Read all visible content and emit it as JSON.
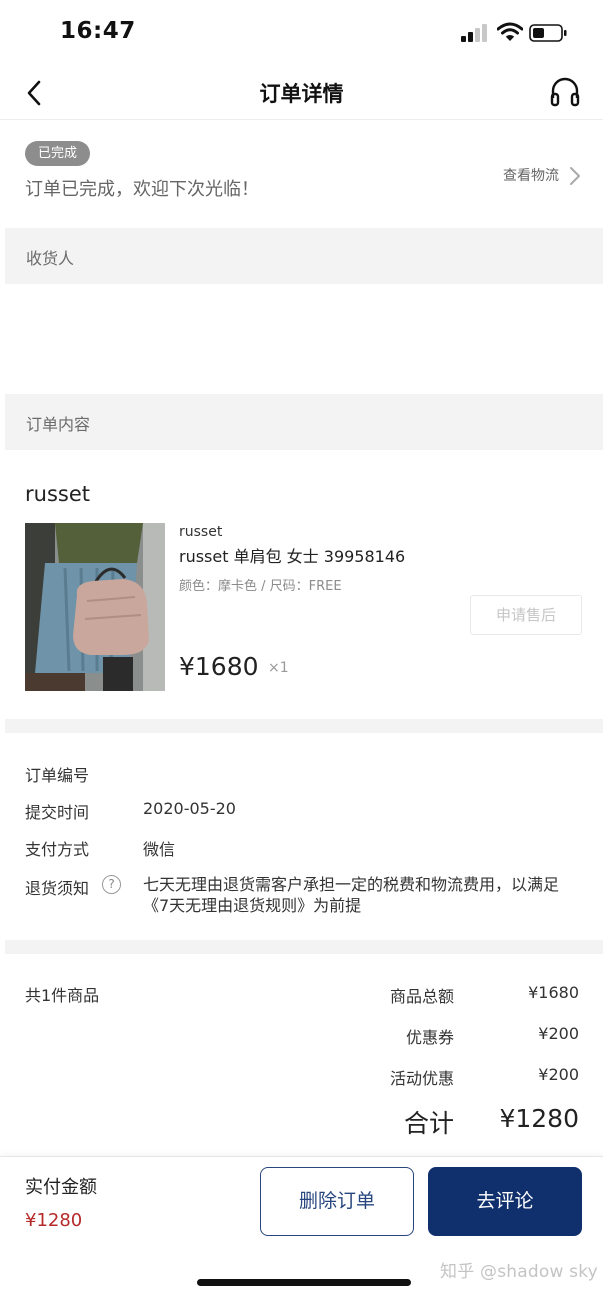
{
  "status_bar": {
    "time": "16:47"
  },
  "nav": {
    "title": "订单详情",
    "back_icon": "chevron-left-icon",
    "service_icon": "headset-icon"
  },
  "order_status": {
    "badge": "已完成",
    "message": "订单已完成，欢迎下次光临！",
    "logistics_link": "查看物流"
  },
  "sections": {
    "recipient": "收货人",
    "order_content": "订单内容"
  },
  "product": {
    "store": "russet",
    "brand": "russet",
    "title": "russet 单肩包 女士 39958146",
    "spec": "颜色：摩卡色 / 尺码：FREE",
    "after_sale": "申请售后",
    "price": "¥1680",
    "quantity": "×1"
  },
  "order_info": {
    "order_number_label": "订单编号",
    "submit_time_label": "提交时间",
    "submit_time": "2020-05-20",
    "payment_label": "支付方式",
    "payment": "微信",
    "return_label": "退货须知",
    "return_policy": "七天无理由退货需客户承担一定的税费和物流费用，以满足《7天无理由退货规则》为前提"
  },
  "summary": {
    "count": "共1件商品",
    "goods_total_label": "商品总额",
    "goods_total": "¥1680",
    "coupon_label": "优惠券",
    "coupon": "¥200",
    "promo_label": "活动优惠",
    "promo": "¥200",
    "total_label": "合计",
    "total": "¥1280"
  },
  "bottom": {
    "paid_label": "实付金额",
    "paid_amount": "¥1280",
    "delete_button": "删除订单",
    "review_button": "去评论",
    "watermark": "知乎 @shadow sky"
  },
  "colors": {
    "primary": "#10306d",
    "price_red": "#b62a2a",
    "section_bg": "#f3f3f3"
  }
}
